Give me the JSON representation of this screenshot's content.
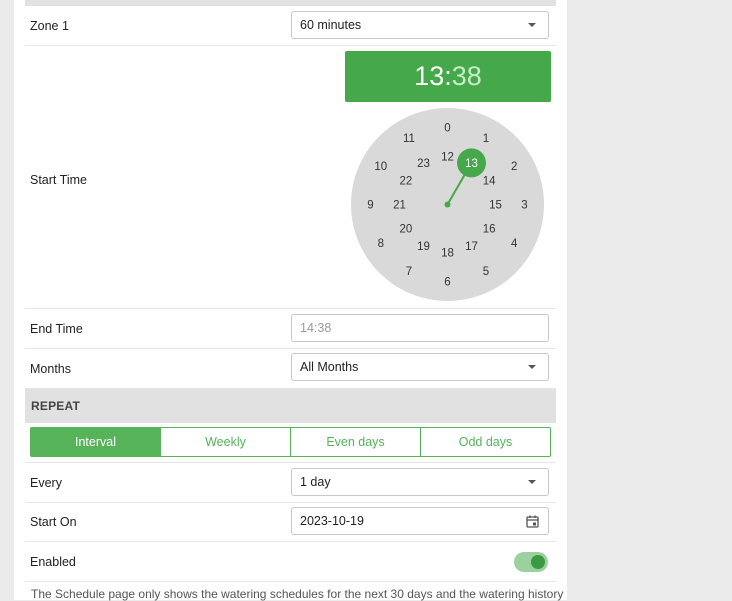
{
  "zone": {
    "label": "Zone 1",
    "duration": "60 minutes"
  },
  "start_time": {
    "label": "Start Time",
    "hours": "13",
    "separator": ":",
    "minutes": "38",
    "selected_hour": "13",
    "outer_hours": [
      "0",
      "1",
      "2",
      "3",
      "4",
      "5",
      "6",
      "7",
      "8",
      "9",
      "10",
      "11"
    ],
    "inner_hours": [
      "12",
      "13",
      "14",
      "15",
      "16",
      "17",
      "18",
      "19",
      "20",
      "21",
      "22",
      "23"
    ]
  },
  "end_time": {
    "label": "End Time",
    "placeholder": "14:38"
  },
  "months": {
    "label": "Months",
    "value": "All Months"
  },
  "repeat": {
    "heading": "REPEAT",
    "tabs": [
      {
        "label": "Interval",
        "active": true
      },
      {
        "label": "Weekly",
        "active": false
      },
      {
        "label": "Even days",
        "active": false
      },
      {
        "label": "Odd days",
        "active": false
      }
    ]
  },
  "every": {
    "label": "Every",
    "value": "1 day"
  },
  "start_on": {
    "label": "Start On",
    "value": "2023-10-19"
  },
  "enabled": {
    "label": "Enabled",
    "on": true
  },
  "footer": {
    "text": "The Schedule page only shows the watering schedules for the next 30 days and the watering history"
  },
  "colors": {
    "accent": "#45a84a",
    "tab_accent": "#56b35a",
    "dial": "#d9d9d9"
  },
  "icons": {
    "dropdown": "chevron-down-icon",
    "calendar": "calendar-icon"
  }
}
